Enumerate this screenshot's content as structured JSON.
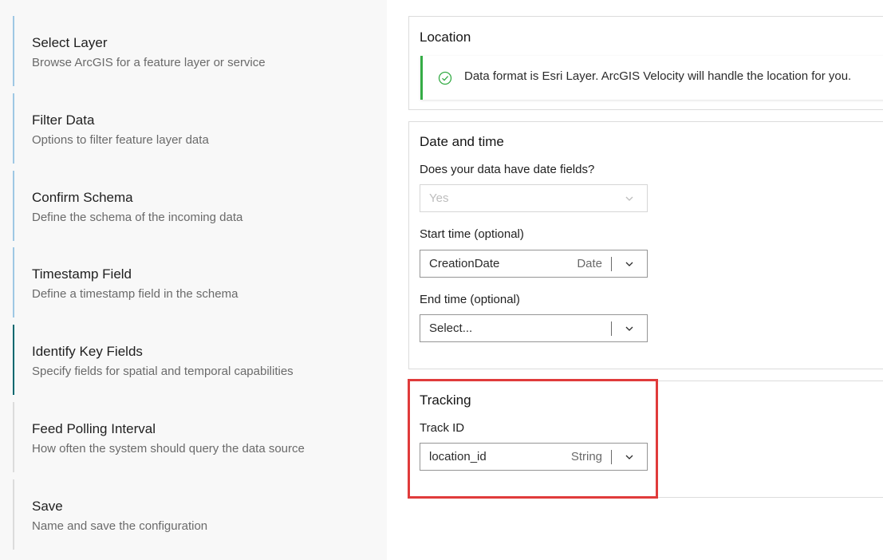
{
  "steps": [
    {
      "title": "Select Layer",
      "desc": "Browse ArcGIS for a feature layer or service",
      "state": "done"
    },
    {
      "title": "Filter Data",
      "desc": "Options to filter feature layer data",
      "state": "done"
    },
    {
      "title": "Confirm Schema",
      "desc": "Define the schema of the incoming data",
      "state": "done"
    },
    {
      "title": "Timestamp Field",
      "desc": "Define a timestamp field in the schema",
      "state": "done"
    },
    {
      "title": "Identify Key Fields",
      "desc": "Specify fields for spatial and temporal capabilities",
      "state": "active"
    },
    {
      "title": "Feed Polling Interval",
      "desc": "How often the system should query the data source",
      "state": "inactive"
    },
    {
      "title": "Save",
      "desc": "Name and save the configuration",
      "state": "inactive"
    }
  ],
  "location": {
    "title": "Location",
    "notice": "Data format is Esri Layer. ArcGIS Velocity will handle the location for you.",
    "notice_icon": "check-circle-icon"
  },
  "datetime": {
    "title": "Date and time",
    "has_date_label": "Does your data have date fields?",
    "has_date_value": "Yes",
    "start_label": "Start time (optional)",
    "start_value": "CreationDate",
    "start_type": "Date",
    "end_label": "End time (optional)",
    "end_placeholder": "Select..."
  },
  "tracking": {
    "title": "Tracking",
    "track_label": "Track ID",
    "track_value": "location_id",
    "track_type": "String"
  },
  "colors": {
    "accent_active": "#00686f",
    "step_done": "#9fc8e4",
    "success": "#35ac46",
    "highlight": "#e03b3b"
  }
}
